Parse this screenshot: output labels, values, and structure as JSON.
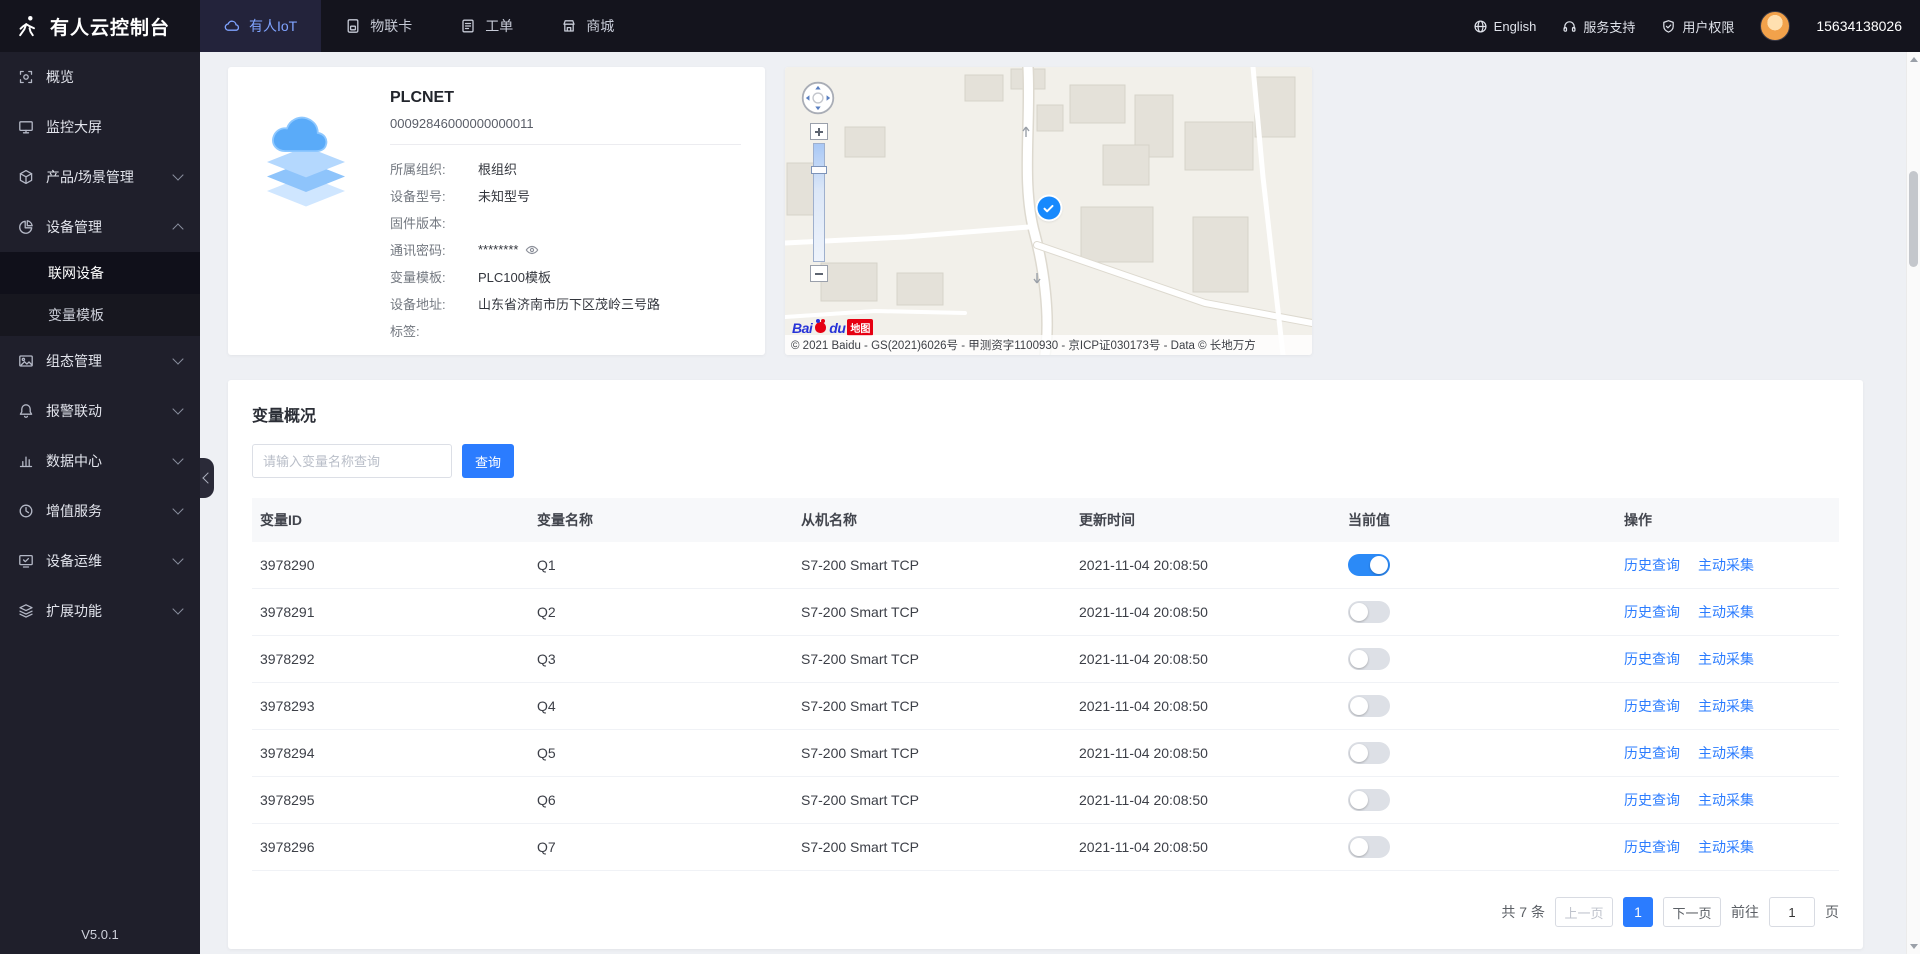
{
  "topbar": {
    "logo": "有人云控制台",
    "tabs": [
      {
        "key": "iot",
        "icon": "cloud",
        "label": "有人IoT",
        "active": true
      },
      {
        "key": "sim-card",
        "icon": "sim",
        "label": "物联卡",
        "active": false
      },
      {
        "key": "work-order",
        "icon": "doc",
        "label": "工单",
        "active": false
      },
      {
        "key": "mall",
        "icon": "store",
        "label": "商城",
        "active": false
      }
    ],
    "right_items": [
      {
        "key": "language",
        "icon": "globe",
        "label": "English"
      },
      {
        "key": "support",
        "icon": "headset",
        "label": "服务支持"
      },
      {
        "key": "permissions",
        "icon": "shield",
        "label": "用户权限"
      }
    ],
    "phone": "15634138026"
  },
  "sidebar": {
    "items": [
      {
        "key": "overview",
        "icon": "overview",
        "label": "概览"
      },
      {
        "key": "monitor-screen",
        "icon": "screen",
        "label": "监控大屏"
      },
      {
        "key": "product-management",
        "icon": "box",
        "label": "产品/场景管理",
        "chevron": "down"
      },
      {
        "key": "device-management",
        "icon": "pie",
        "label": "设备管理",
        "chevron": "up",
        "expanded": true,
        "children": [
          {
            "key": "connected-devices",
            "label": "联网设备",
            "active": true
          },
          {
            "key": "variable-templates",
            "label": "变量模板",
            "active": false
          }
        ]
      },
      {
        "key": "config-management",
        "icon": "image",
        "label": "组态管理",
        "chevron": "down"
      },
      {
        "key": "alarm-linkage",
        "icon": "bell",
        "label": "报警联动",
        "chevron": "down"
      },
      {
        "key": "data-center",
        "icon": "chart",
        "label": "数据中心",
        "chevron": "down"
      },
      {
        "key": "value-added",
        "icon": "clock",
        "label": "增值服务",
        "chevron": "down"
      },
      {
        "key": "device-ops",
        "icon": "ops",
        "label": "设备运维",
        "chevron": "down"
      },
      {
        "key": "extensions",
        "icon": "layers",
        "label": "扩展功能",
        "chevron": "down"
      }
    ],
    "version": "V5.0.1"
  },
  "device": {
    "name": "PLCNET",
    "id": "00092846000000000011",
    "fields": [
      {
        "label": "所属组织:",
        "value": "根组织"
      },
      {
        "label": "设备型号:",
        "value": "未知型号"
      },
      {
        "label": "固件版本:",
        "value": ""
      },
      {
        "label": "通讯密码:",
        "value": "********",
        "eye": true
      },
      {
        "label": "变量模板:",
        "value": "PLC100模板"
      },
      {
        "label": "设备地址:",
        "value": "山东省济南市历下区茂岭三号路"
      },
      {
        "label": "标签:",
        "value": ""
      }
    ]
  },
  "map": {
    "logo_left": "Bai",
    "logo_right": "du",
    "logo_tag": "地图",
    "copyright": "© 2021 Baidu - GS(2021)6026号 - 甲测资字1100930 - 京ICP证030173号 - Data © 长地万方"
  },
  "variables": {
    "title": "变量概况",
    "search_placeholder": "请输入变量名称查询",
    "search_button": "查询",
    "table": {
      "headers": [
        "变量ID",
        "变量名称",
        "从机名称",
        "更新时间",
        "当前值",
        "操作"
      ],
      "actions": [
        "历史查询",
        "主动采集"
      ],
      "rows": [
        {
          "id": "3978290",
          "name": "Q1",
          "slave": "S7-200 Smart TCP",
          "time": "2021-11-04 20:08:50",
          "on": true
        },
        {
          "id": "3978291",
          "name": "Q2",
          "slave": "S7-200 Smart TCP",
          "time": "2021-11-04 20:08:50",
          "on": false
        },
        {
          "id": "3978292",
          "name": "Q3",
          "slave": "S7-200 Smart TCP",
          "time": "2021-11-04 20:08:50",
          "on": false
        },
        {
          "id": "3978293",
          "name": "Q4",
          "slave": "S7-200 Smart TCP",
          "time": "2021-11-04 20:08:50",
          "on": false
        },
        {
          "id": "3978294",
          "name": "Q5",
          "slave": "S7-200 Smart TCP",
          "time": "2021-11-04 20:08:50",
          "on": false
        },
        {
          "id": "3978295",
          "name": "Q6",
          "slave": "S7-200 Smart TCP",
          "time": "2021-11-04 20:08:50",
          "on": false
        },
        {
          "id": "3978296",
          "name": "Q7",
          "slave": "S7-200 Smart TCP",
          "time": "2021-11-04 20:08:50",
          "on": false
        }
      ]
    },
    "pagination": {
      "total": "共 7 条",
      "prev": "上一页",
      "current": "1",
      "next": "下一页",
      "jump_prefix": "前往",
      "jump_value": "1",
      "jump_suffix": "页"
    }
  },
  "colors": {
    "accent": "#2b7cff",
    "topbar_bg": "#14141d",
    "sidebar_bg": "#1f1f2b",
    "toggle_on": "#2b8af7",
    "marker_blue": "#1789fd"
  }
}
